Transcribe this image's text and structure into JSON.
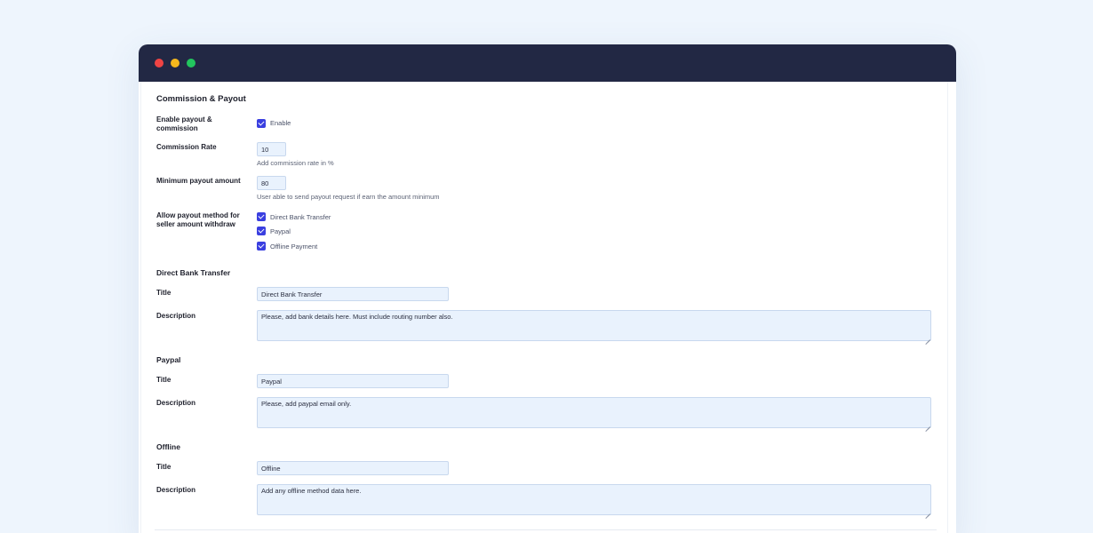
{
  "window": {
    "controls": [
      "close",
      "minimize",
      "maximize"
    ]
  },
  "colors": {
    "titlebar": "#222844",
    "accent": "#3a3fe0",
    "field_bg": "#e9f2fd",
    "page_bg": "#eef5fd"
  },
  "commission": {
    "heading": "Commission & Payout",
    "enable": {
      "label": "Enable payout & commission",
      "option": "Enable",
      "checked": true
    },
    "rate": {
      "label": "Commission Rate",
      "value": "10",
      "hint": "Add commission rate in %"
    },
    "minimum": {
      "label": "Minimum payout amount",
      "value": "80",
      "hint": "User able to send payout request if earn the amount minimum"
    },
    "methods": {
      "label": "Allow payout method for seller amount withdraw",
      "options": [
        {
          "label": "Direct Bank Transfer",
          "checked": true
        },
        {
          "label": "Paypal",
          "checked": true
        },
        {
          "label": "Offline Payment",
          "checked": true
        }
      ]
    }
  },
  "bank": {
    "heading": "Direct Bank Transfer",
    "title_label": "Title",
    "title_value": "Direct Bank Transfer",
    "desc_label": "Description",
    "desc_value": "Please, add bank details here. Must include routing number also."
  },
  "paypal": {
    "heading": "Paypal",
    "title_label": "Title",
    "title_value": "Paypal",
    "desc_label": "Description",
    "desc_value": "Please, add paypal email only."
  },
  "offline": {
    "heading": "Offline",
    "title_label": "Title",
    "title_value": "Offline",
    "desc_label": "Description",
    "desc_value": "Add any offline method data here."
  }
}
